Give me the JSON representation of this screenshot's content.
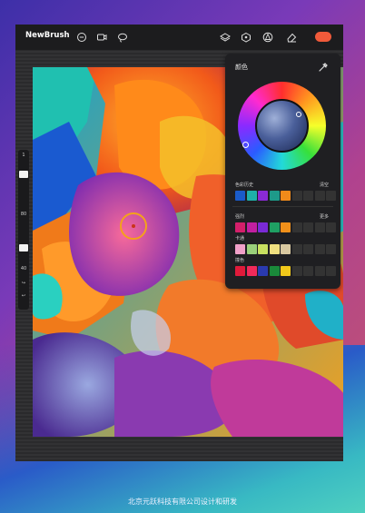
{
  "app": {
    "name": "NewBrush"
  },
  "toolbar": {
    "left_icons": [
      "minus-circle-icon",
      "video-icon",
      "lasso-icon"
    ],
    "right_icons": [
      "layers-icon",
      "smudge-icon",
      "adjust-icon",
      "eraser-icon"
    ],
    "active_color": "#f05a3a"
  },
  "sidebar": {
    "top_label": "1",
    "mid_label_a": "80",
    "mid_label_b": "40",
    "undo_icon": "undo-icon",
    "redo_icon": "redo-icon"
  },
  "color_panel": {
    "title": "颜色",
    "history_label": "色彩历史",
    "clear_label": "清空",
    "palette_label": "强烈",
    "more_label": "更多",
    "row2_label": "卡通",
    "row3_label": "撞色",
    "history": [
      "#1a5bc9",
      "#1fb0a8",
      "#8a2ad6",
      "#1e9a8a",
      "#f08a1a",
      "#333333",
      "#333333",
      "#333333",
      "#333333"
    ],
    "palette_rows": [
      [
        "#d41f6a",
        "#c21fa0",
        "#7a2ad6",
        "#1fa063",
        "#f0901a",
        "#333333",
        "#333333",
        "#333333",
        "#333333"
      ],
      [
        "#f0a0c8",
        "#9ad07a",
        "#c8e060",
        "#f0e080",
        "#d8c8a0",
        "#333333",
        "#333333",
        "#333333",
        "#333333"
      ],
      [
        "#e01a3a",
        "#f02a5a",
        "#2a3ab0",
        "#1a8a3a",
        "#f0c81a",
        "#333333",
        "#333333",
        "#333333",
        "#333333"
      ]
    ]
  },
  "footer": {
    "text": "北京元跃科技有限公司设计和研发"
  }
}
